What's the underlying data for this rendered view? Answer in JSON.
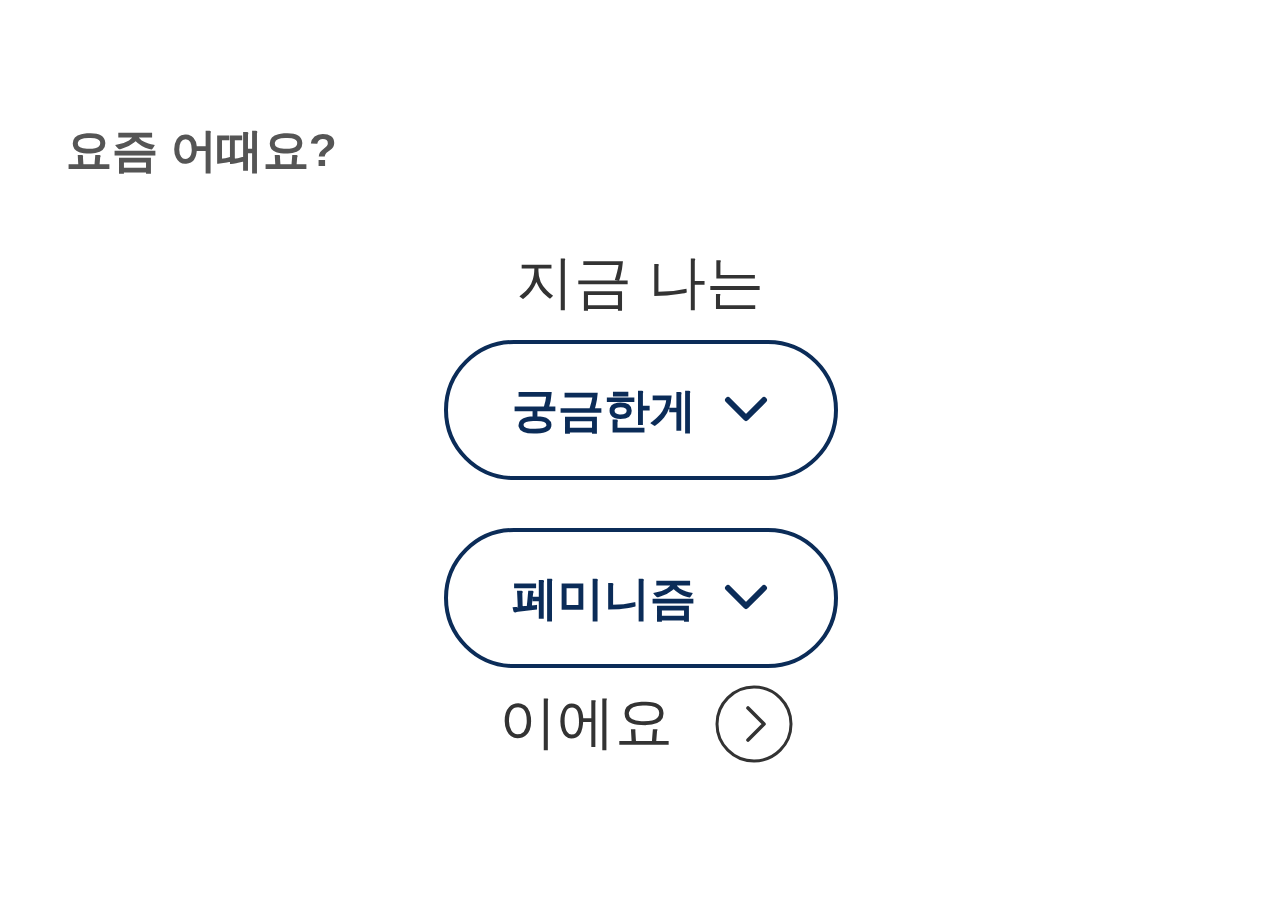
{
  "heading": "요즘 어때요?",
  "lead": "지금 나는",
  "dropdowns": [
    {
      "label": "궁금한게"
    },
    {
      "label": "페미니즘"
    }
  ],
  "suffix": "이에요"
}
